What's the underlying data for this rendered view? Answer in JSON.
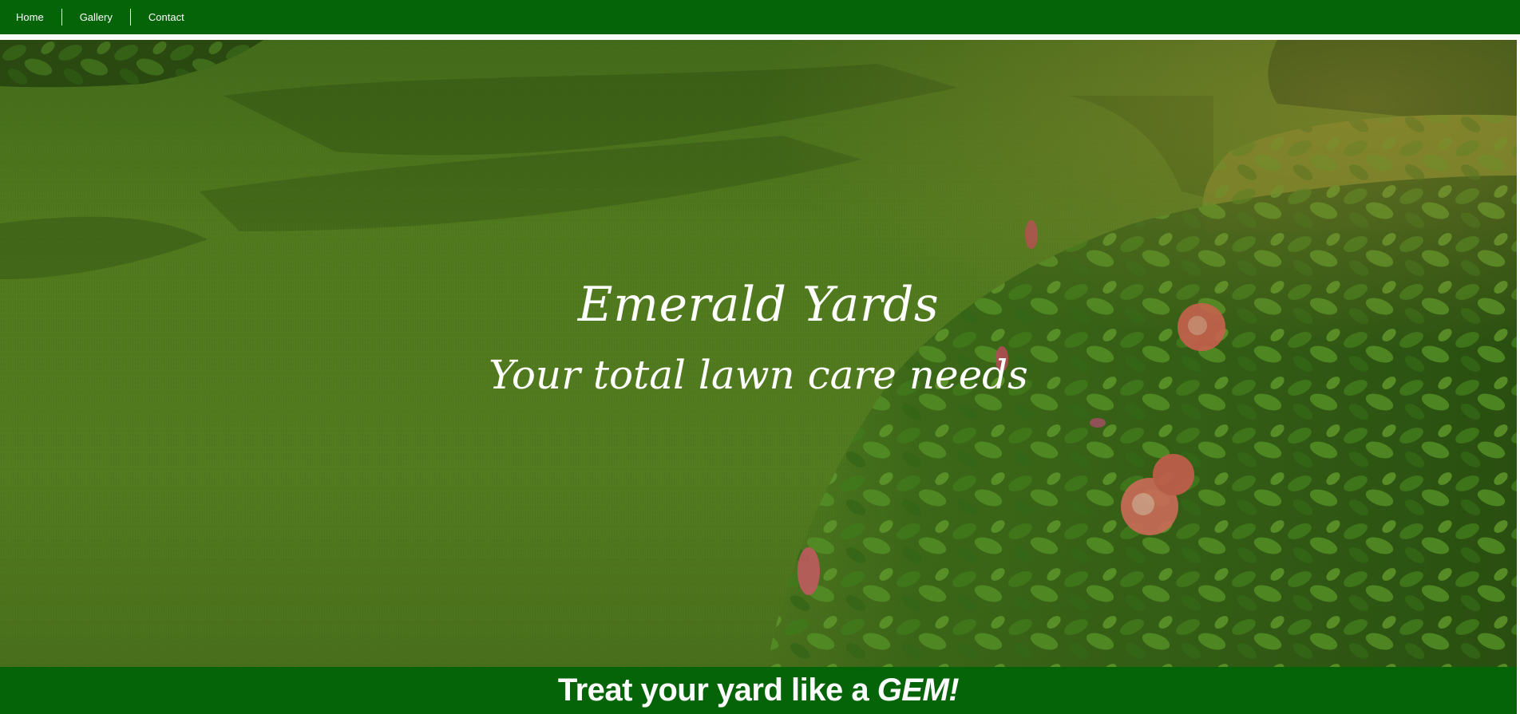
{
  "nav": {
    "items": [
      {
        "label": "Home"
      },
      {
        "label": "Gallery"
      },
      {
        "label": "Contact"
      }
    ]
  },
  "hero": {
    "title": "Emerald Yards",
    "subtitle": "Your total lawn care needs",
    "background": "lawn-with-hibiscus-bushes-image"
  },
  "banner": {
    "text_prefix": "Treat your yard like a ",
    "text_emphasis": "GEM!"
  },
  "colors": {
    "brand_green": "#066408",
    "text": "#ffffff"
  }
}
